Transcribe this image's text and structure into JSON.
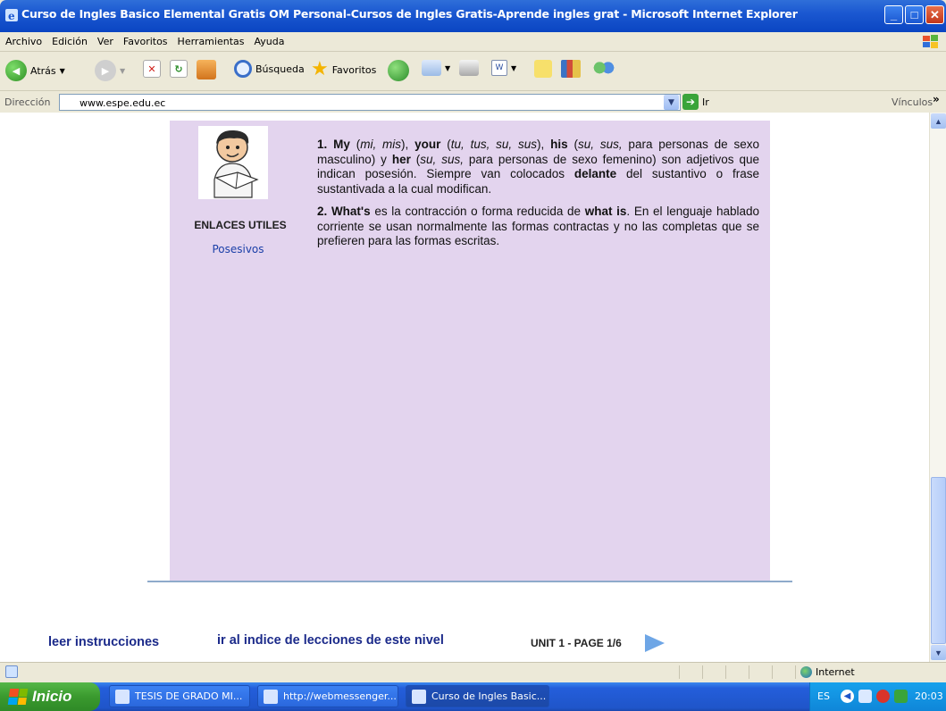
{
  "window": {
    "title": "Curso de Ingles Basico Elemental Gratis OM Personal-Cursos de Ingles Gratis-Aprende ingles grat - Microsoft Internet Explorer"
  },
  "menubar": {
    "items": [
      "Archivo",
      "Edición",
      "Ver",
      "Favoritos",
      "Herramientas",
      "Ayuda"
    ]
  },
  "toolbar": {
    "back_label": "Atrás",
    "search_label": "Búsqueda",
    "favorites_label": "Favoritos"
  },
  "address": {
    "label": "Dirección",
    "url": "www.espe.edu.ec",
    "go_label": "Ir",
    "links_label": "Vínculos"
  },
  "page": {
    "sidebar_heading": "ENLACES UTILES",
    "sidebar_link": "Posesivos",
    "bottom_nav": {
      "instructions": "leer instrucciones",
      "index": "ir al indice de lecciones de este nivel",
      "unit": "UNIT 1 - PAGE 1/6"
    }
  },
  "statusbar": {
    "zone": "Internet"
  },
  "taskbar": {
    "start_label": "Inicio",
    "tasks": [
      {
        "label": "TESIS DE GRADO MI..."
      },
      {
        "label": "http://webmessenger..."
      },
      {
        "label": "Curso de Ingles Basic..."
      }
    ],
    "lang": "ES",
    "clock": "20:03"
  }
}
